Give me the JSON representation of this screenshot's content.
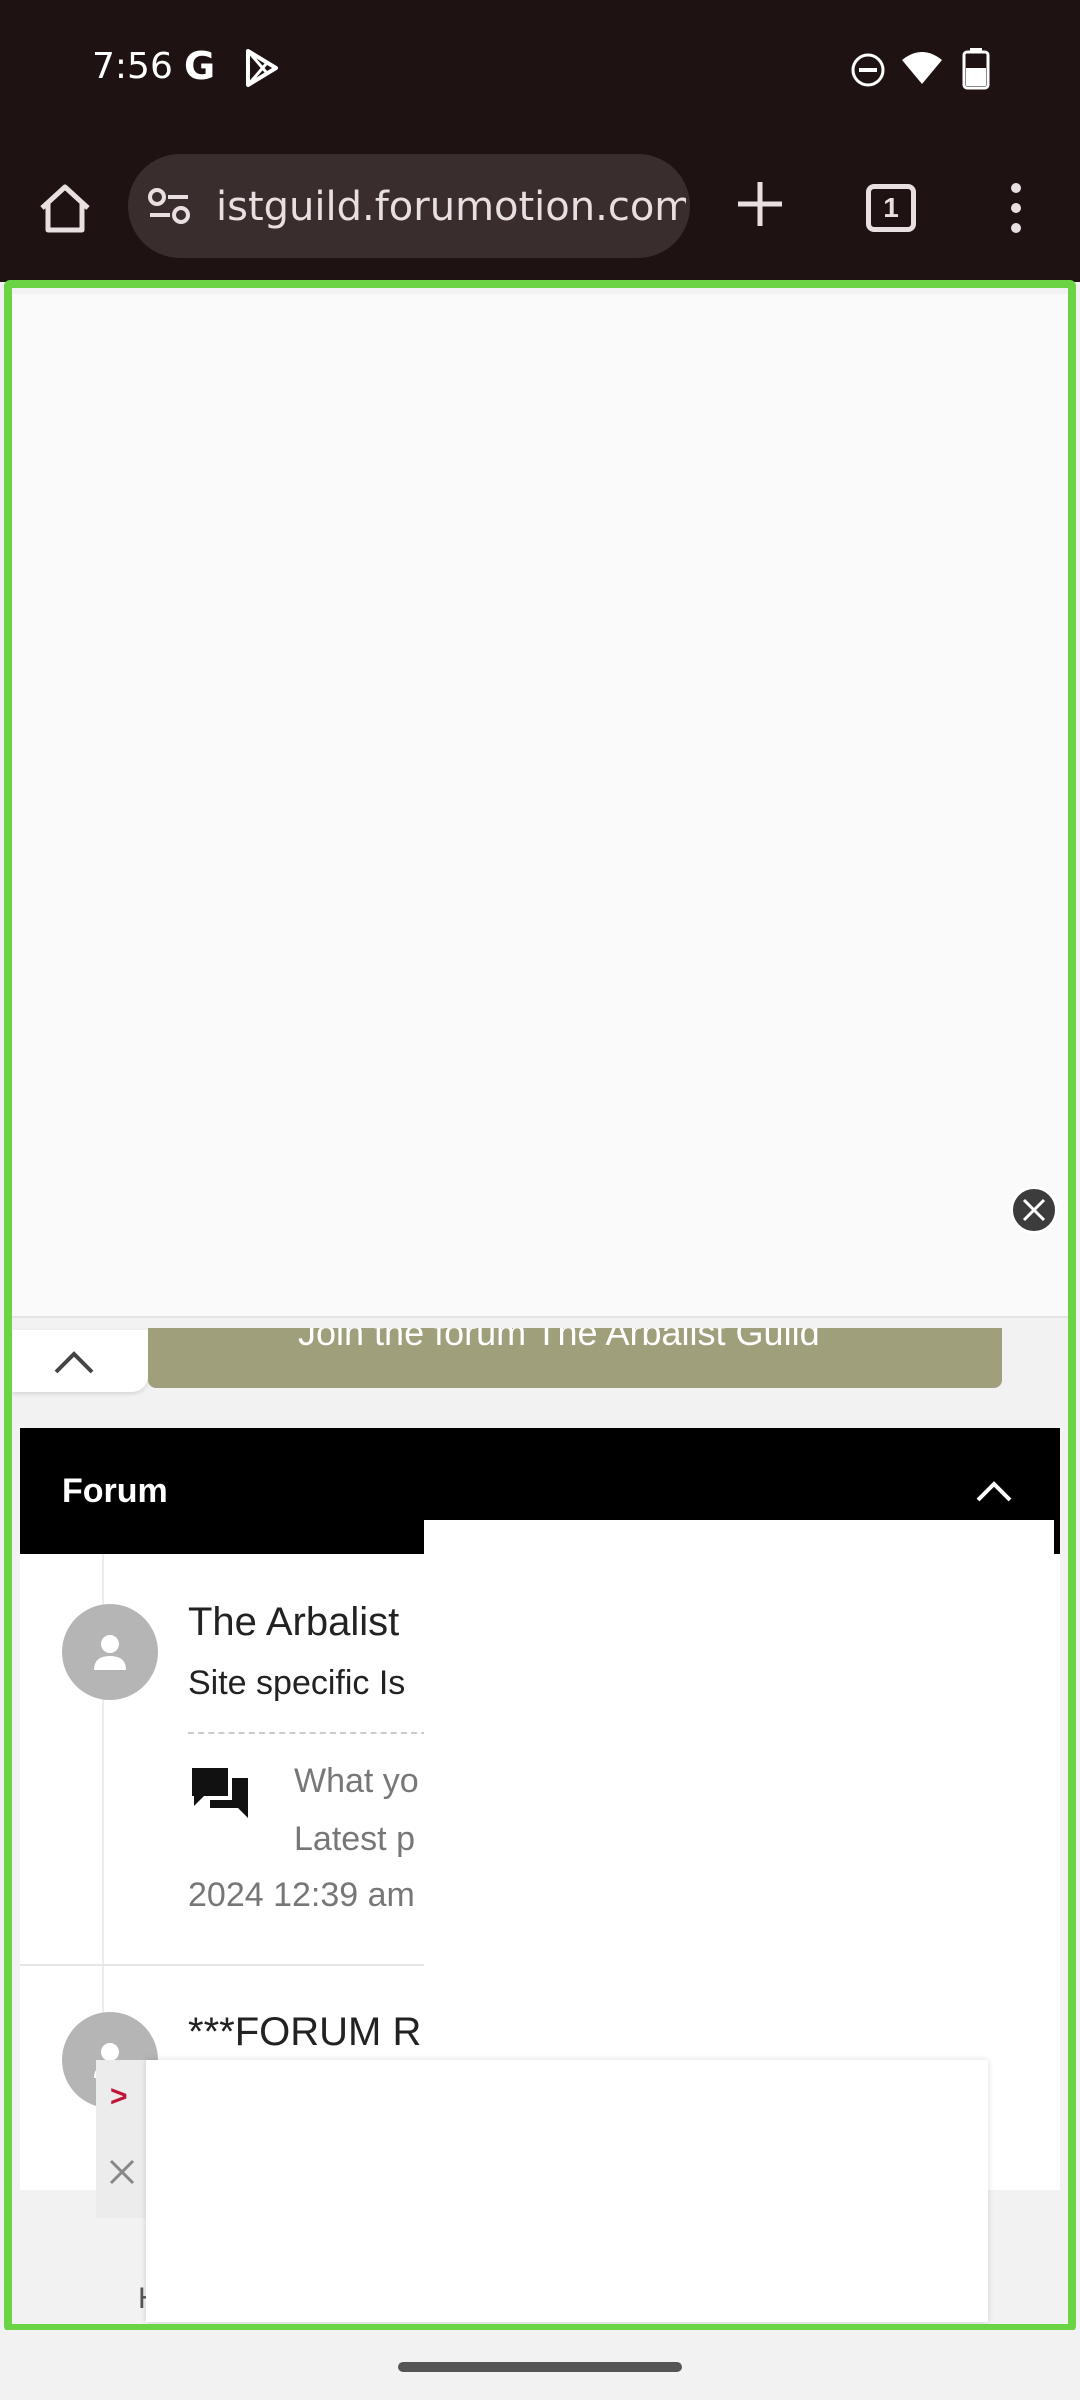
{
  "status_bar": {
    "time": "7:56",
    "g_label": "G"
  },
  "browser": {
    "url": "istguild.forumotion.com",
    "tab_count": "1"
  },
  "join_bar": {
    "text": "Join the forum The Arbalist Guild"
  },
  "forum": {
    "header_title": "Forum",
    "items": [
      {
        "name": "The Arbalist",
        "description": "Site specific Is",
        "latest_line1": "What yo",
        "latest_line2": "Latest p",
        "latest_date": "2024 12:39 am"
      },
      {
        "name": "***FORUM R"
      }
    ]
  },
  "bottom": {
    "letter": "H"
  },
  "ad_controls": {
    "arrow": ">"
  },
  "colors": {
    "frame": "#6ad444",
    "join_bar": "#a09f7c",
    "status_bar": "#1e1212"
  }
}
